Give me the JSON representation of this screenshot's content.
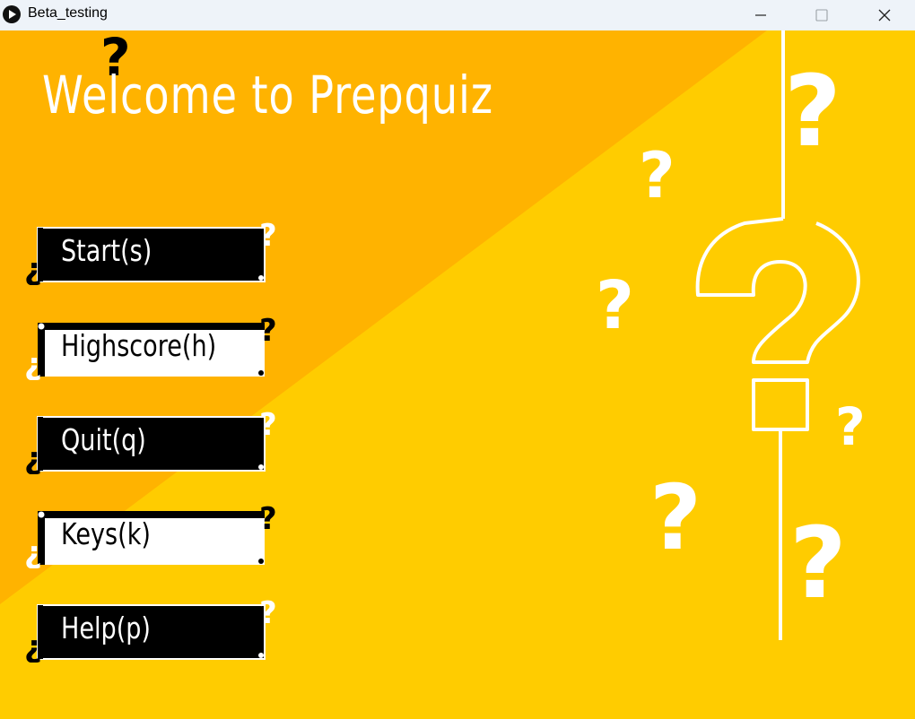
{
  "window": {
    "title": "Beta_testing",
    "icon": "play-icon",
    "controls": [
      "minimize-icon",
      "maximize-icon",
      "close-icon"
    ]
  },
  "main": {
    "heading": "Welcome to Prepquiz"
  },
  "menu": {
    "items": [
      {
        "label": "Start(s)",
        "style": "dark"
      },
      {
        "label": "Highscore(h)",
        "style": "light"
      },
      {
        "label": "Quit(q)",
        "style": "dark"
      },
      {
        "label": "Keys(k)",
        "style": "light"
      },
      {
        "label": "Help(p)",
        "style": "dark"
      }
    ]
  },
  "colors": {
    "background": "#ffcc00",
    "diagonal_band": "#ffb300",
    "titlebar": "#eef3f9",
    "button_dark": "#000000",
    "button_light": "#ffffff",
    "accent_white": "#ffffff"
  },
  "icons": {
    "decorations": [
      "question-mark-icon",
      "big-question-mark-icon",
      "inverted-question-mark-icon"
    ]
  }
}
